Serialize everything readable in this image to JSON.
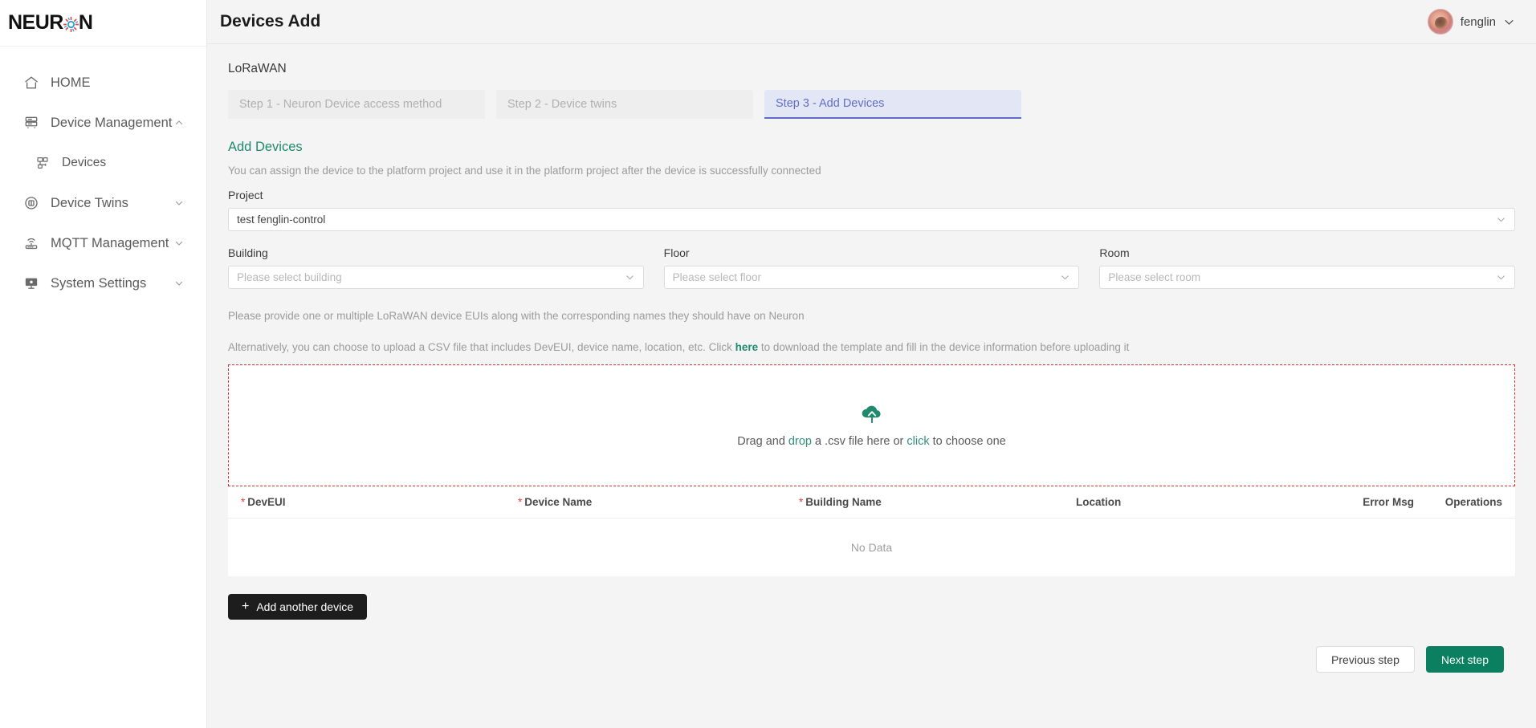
{
  "brand": {
    "logo_part1": "NEUR",
    "logo_part2": "N",
    "gear_color_blue": "#2aa4d6",
    "gear_color_red": "#e8414a"
  },
  "sidebar": {
    "items": [
      {
        "label": "HOME",
        "icon": "home-icon",
        "sub": false,
        "chevron": false
      },
      {
        "label": "Device Management",
        "icon": "server-icon",
        "sub": false,
        "chevron": true
      },
      {
        "label": "Devices",
        "icon": "device-icon",
        "sub": true,
        "chevron": false
      },
      {
        "label": "Device Twins",
        "icon": "twins-icon",
        "sub": false,
        "chevron": true
      },
      {
        "label": "MQTT Management",
        "icon": "router-icon",
        "sub": false,
        "chevron": true
      },
      {
        "label": "System Settings",
        "icon": "monitor-icon",
        "sub": false,
        "chevron": true
      }
    ]
  },
  "header": {
    "title": "Devices Add",
    "user_name": "fenglin"
  },
  "main": {
    "network_label": "LoRaWAN",
    "steps": [
      {
        "label": "Step 1 - Neuron Device access method",
        "active": false
      },
      {
        "label": "Step 2 - Device twins",
        "active": false
      },
      {
        "label": "Step 3 - Add Devices",
        "active": true
      }
    ],
    "section_title": "Add Devices",
    "section_desc": "You can assign the device to the platform project and use it in the platform project after the device is successfully connected",
    "project": {
      "label": "Project",
      "value": "test fenglin-control"
    },
    "building": {
      "label": "Building",
      "placeholder": "Please select building"
    },
    "floor": {
      "label": "Floor",
      "placeholder": "Please select floor"
    },
    "room": {
      "label": "Room",
      "placeholder": "Please select room"
    },
    "hint1": "Please provide one or multiple LoRaWAN device EUIs along with the corresponding names they should have on Neuron",
    "hint2_pre": "Alternatively, you can choose to upload a CSV file that includes DevEUI, device name, location, etc. Click",
    "hint2_link": "here",
    "hint2_post": "to download the template and fill in the device information before uploading it",
    "dropzone": {
      "pre": "Drag and ",
      "link1": "drop",
      "mid": " a .csv file here or ",
      "link2": "click",
      "post": " to choose one"
    },
    "table": {
      "columns": [
        {
          "key": "deveui",
          "label": "DevEUI",
          "required": true
        },
        {
          "key": "device_name",
          "label": "Device Name",
          "required": true
        },
        {
          "key": "building_name",
          "label": "Building Name",
          "required": true
        },
        {
          "key": "location",
          "label": "Location",
          "required": false
        },
        {
          "key": "error_msg",
          "label": "Error Msg",
          "required": false
        },
        {
          "key": "operations",
          "label": "Operations",
          "required": false
        }
      ],
      "rows": [],
      "empty_text": "No Data"
    },
    "add_device_button": "Add another device",
    "previous_button": "Previous step",
    "next_button": "Next step"
  },
  "colors": {
    "accent_green": "#1f8a6d",
    "next_button_green": "#0a8060",
    "step_active_blue": "#5c6bc8",
    "dropzone_border_red": "#e03131",
    "required_star_red": "#e04141"
  }
}
